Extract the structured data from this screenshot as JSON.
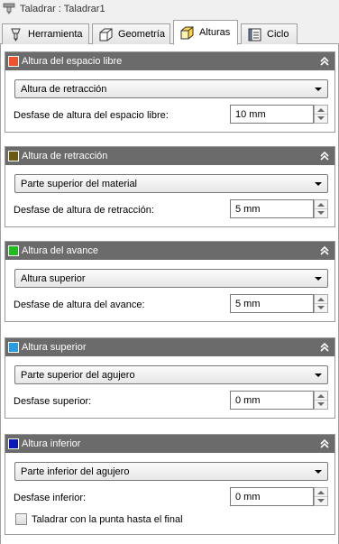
{
  "title": "Taladrar : Taladrar1",
  "tabs": [
    {
      "label": "Herramienta",
      "icon": "tool-holder-icon",
      "active": false
    },
    {
      "label": "Geometría",
      "icon": "geometry-cube-icon",
      "active": false
    },
    {
      "label": "Alturas",
      "icon": "heights-cube-icon",
      "active": true
    },
    {
      "label": "Ciclo",
      "icon": "cycle-list-icon",
      "active": false
    }
  ],
  "sections": [
    {
      "title": "Altura del espacio libre",
      "color": "#f0522c",
      "select_value": "Altura de retracción",
      "offset_label": "Desfase de altura del espacio libre:",
      "offset_value": "10 mm"
    },
    {
      "title": "Altura de retracción",
      "color": "#6b5a12",
      "select_value": "Parte superior del material",
      "offset_label": "Desfase de altura de retracción:",
      "offset_value": "5 mm"
    },
    {
      "title": "Altura del avance",
      "color": "#22bb22",
      "select_value": "Altura superior",
      "offset_label": "Desfase de altura del avance:",
      "offset_value": "5 mm"
    },
    {
      "title": "Altura superior",
      "color": "#2a9be0",
      "select_value": "Parte superior del agujero",
      "offset_label": "Desfase superior:",
      "offset_value": "0 mm"
    },
    {
      "title": "Altura inferior",
      "color": "#0d17b8",
      "select_value": "Parte inferior del agujero",
      "offset_label": "Desfase inferior:",
      "offset_value": "0 mm"
    }
  ],
  "checkbox": {
    "label": "Taladrar con la punta hasta el final",
    "checked": false
  }
}
